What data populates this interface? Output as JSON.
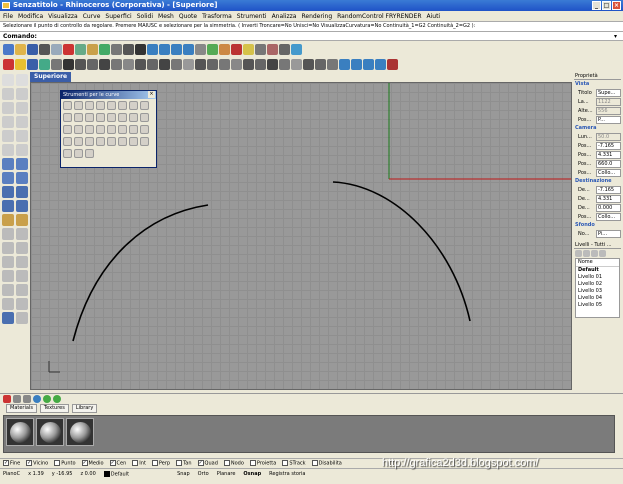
{
  "window": {
    "title": "Senzatitolo - Rhinoceros (Corporativa) - [Superiore]"
  },
  "menu": [
    "File",
    "Modifica",
    "Visualizza",
    "Curve",
    "Superfici",
    "Solidi",
    "Mesh",
    "Quote",
    "Trasforma",
    "Strumenti",
    "Analizza",
    "Rendering",
    "RandomControl FRYRENDER",
    "Aiuti"
  ],
  "command": {
    "history": "Selezionare il punto di controllo da regolare. Premere MAIUSC e selezionare per la simmetria. ( Inverti  Troncare=No  Unisci=No  VisualizzaCurvatura=No  Continuità_1=G2  Continuità_2=G2 ):",
    "prompt": "Comando:"
  },
  "viewport": {
    "label": "Superiore"
  },
  "floating_toolbar": {
    "title": "Strumenti per le curve"
  },
  "properties": {
    "header": "Proprietà",
    "sections": [
      {
        "title": "Vista",
        "rows": [
          {
            "k": "Titolo",
            "v": "Supe..."
          },
          {
            "k": "La...",
            "v": "1122",
            "dim": true
          },
          {
            "k": "Alte...",
            "v": "556",
            "dim": true
          },
          {
            "k": "Pos...",
            "v": "P..."
          }
        ]
      },
      {
        "title": "Camera",
        "rows": [
          {
            "k": "Lun...",
            "v": "50.0",
            "dim": true
          },
          {
            "k": "Pos...",
            "v": "-7.165"
          },
          {
            "k": "Pos...",
            "v": "4.331"
          },
          {
            "k": "Pos...",
            "v": "660.0"
          },
          {
            "k": "Pos...",
            "v": "Collo..."
          }
        ]
      },
      {
        "title": "Destinazione",
        "rows": [
          {
            "k": "De...",
            "v": "-7.165"
          },
          {
            "k": "De...",
            "v": "4.331"
          },
          {
            "k": "De...",
            "v": "0.000"
          },
          {
            "k": "Pos...",
            "v": "Collo..."
          }
        ]
      },
      {
        "title": "Sfondo",
        "rows": [
          {
            "k": "No...",
            "v": "Pi..."
          }
        ]
      }
    ]
  },
  "layers": {
    "header": "Livelli - Tutti ...",
    "column": "Nome",
    "items": [
      "Default",
      "Livello 01",
      "Livello 02",
      "Livello 03",
      "Livello 04",
      "Livello 05"
    ]
  },
  "materials": {
    "tabs": [
      "Materials",
      "Textures",
      "Library"
    ]
  },
  "osnap": [
    {
      "label": "Fine",
      "checked": true
    },
    {
      "label": "Vicino",
      "checked": true
    },
    {
      "label": "Punto",
      "checked": false
    },
    {
      "label": "Medio",
      "checked": true
    },
    {
      "label": "Cen",
      "checked": true
    },
    {
      "label": "Int",
      "checked": false
    },
    {
      "label": "Perp",
      "checked": false
    },
    {
      "label": "Tan",
      "checked": false
    },
    {
      "label": "Quad",
      "checked": true
    },
    {
      "label": "Nodo",
      "checked": false
    },
    {
      "label": "Proietta",
      "checked": false
    },
    {
      "label": "STrack",
      "checked": false
    },
    {
      "label": "Disabilita",
      "checked": false
    }
  ],
  "status": {
    "cplane": "PianoC",
    "x": "x 1.39",
    "y": "y -16.95",
    "z": "z 0.00",
    "layer": "Default",
    "toggles": [
      "Snap",
      "Orto",
      "Planare",
      "Osnap",
      "Registra storia"
    ]
  },
  "watermark": "http://grafica2d3d.blogspot.com/"
}
